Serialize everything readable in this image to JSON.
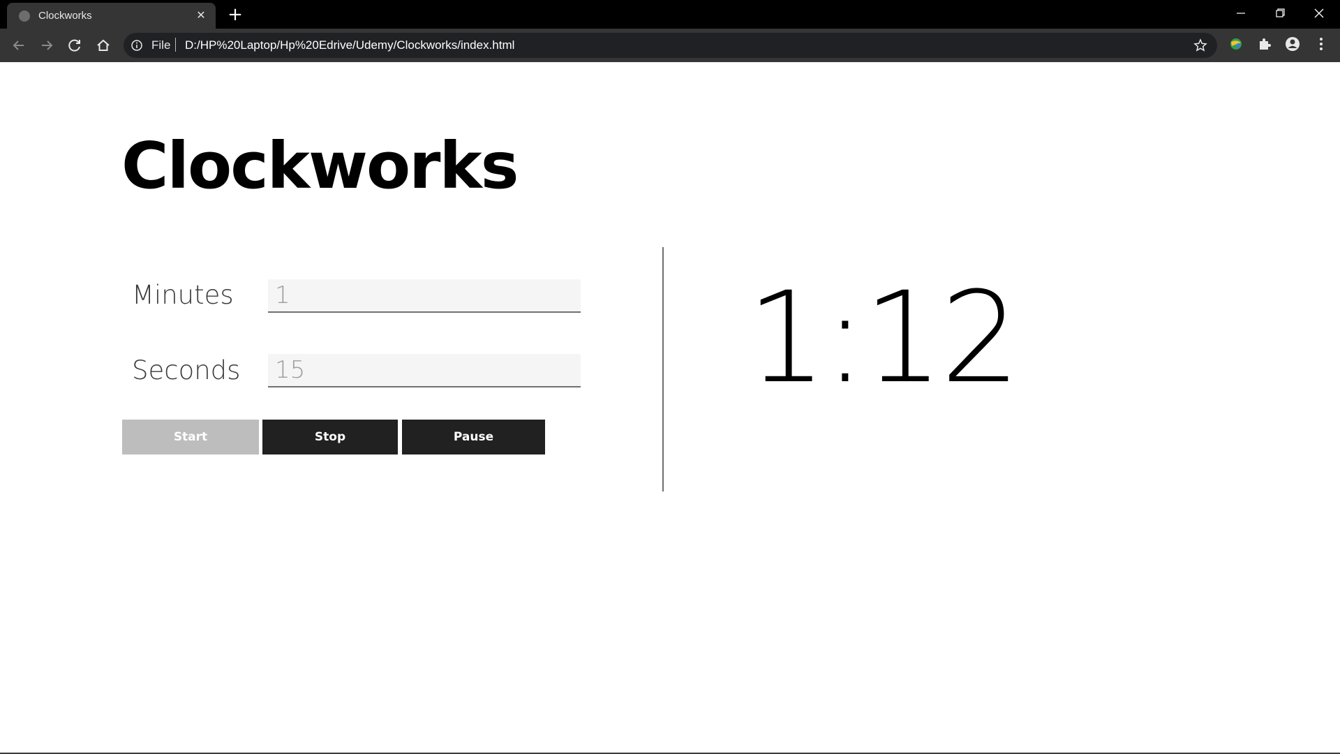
{
  "browser": {
    "tab_title": "Clockworks",
    "address_scheme": "File",
    "address_url": "D:/HP%20Laptop/Hp%20Edrive/Udemy/Clockworks/index.html",
    "icons": [
      "favicon-icon",
      "close-icon",
      "plus-icon",
      "minimize-icon",
      "restore-icon",
      "close-window-icon",
      "back-arrow-icon",
      "forward-arrow-icon",
      "reload-icon",
      "home-icon",
      "info-icon",
      "star-icon",
      "extension-globe-icon",
      "puzzle-icon",
      "profile-icon",
      "kebab-menu-icon"
    ]
  },
  "page": {
    "title": "Clockworks",
    "minutes_label": "Minutes",
    "minutes_value": "1",
    "seconds_label": "Seconds",
    "seconds_value": "15",
    "start_label": "Start",
    "stop_label": "Stop",
    "pause_label": "Pause",
    "timer_display": "1:12"
  },
  "colors": {
    "chrome_bg": "#000000",
    "toolbar_bg": "#353535",
    "omnibox_bg": "#202124",
    "start_disabled": "#bdbdbd",
    "button_dark": "#212121",
    "input_bg": "#f5f5f5"
  }
}
